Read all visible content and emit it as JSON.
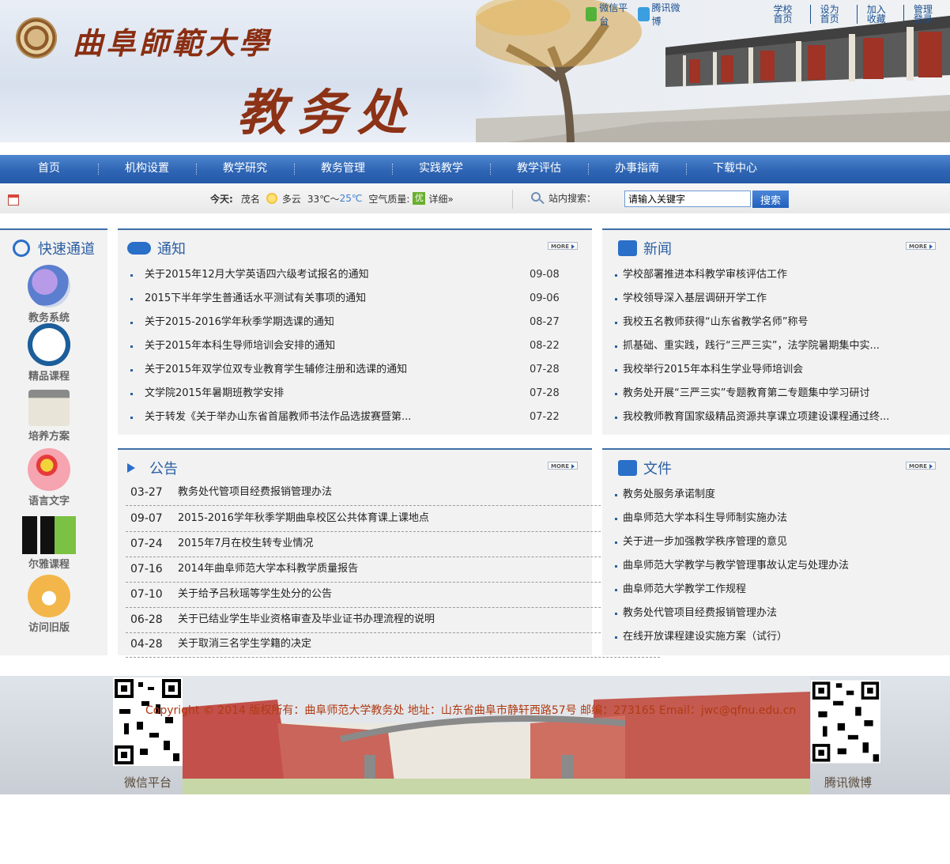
{
  "header": {
    "university_name": "曲阜師範大學",
    "office_name": "教务处",
    "social": [
      {
        "icon": "wechat-icon",
        "label": "微信平台"
      },
      {
        "icon": "weibo-icon",
        "label": "腾讯微博"
      }
    ],
    "top_links": [
      "学校首页",
      "设为首页",
      "加入收藏",
      "管理登录"
    ]
  },
  "nav": [
    "首页",
    "机构设置",
    "教学研究",
    "教务管理",
    "实践教学",
    "教学评估",
    "办事指南",
    "下载中心"
  ],
  "weather": {
    "today_label": "今天:",
    "location": "茂名",
    "condition": "多云",
    "temp_high": "33℃～",
    "temp_low": "25℃",
    "air_label": "空气质量:",
    "air_value": "优",
    "detail": "详细»"
  },
  "search": {
    "label": "站内搜索：",
    "value": "请输入关键字",
    "button": "搜索"
  },
  "quick_links": {
    "title": "快速通道",
    "items": [
      {
        "label": "教务系统",
        "icon": "academic-system-icon"
      },
      {
        "label": "精品课程",
        "icon": "quality-course-icon"
      },
      {
        "label": "培养方案",
        "icon": "news-paper-icon"
      },
      {
        "label": "语言文字",
        "icon": "language-icon"
      },
      {
        "label": "尔雅课程",
        "icon": "erya-logo"
      },
      {
        "label": "访问旧版",
        "icon": "old-version-icon"
      }
    ]
  },
  "notice": {
    "title": "通知",
    "more": "MORE",
    "items": [
      {
        "title": "关于2015年12月大学英语四六级考试报名的通知",
        "date": "09-08"
      },
      {
        "title": "2015下半年学生普通话水平测试有关事项的通知",
        "date": "09-06"
      },
      {
        "title": "关于2015-2016学年秋季学期选课的通知",
        "date": "08-27"
      },
      {
        "title": "关于2015年本科生导师培训会安排的通知",
        "date": "08-22"
      },
      {
        "title": "关于2015年双学位双专业教育学生辅修注册和选课的通知",
        "date": "07-28"
      },
      {
        "title": "文学院2015年暑期班教学安排",
        "date": "07-28"
      },
      {
        "title": "关于转发《关于举办山东省首届教师书法作品选拔赛暨第...",
        "date": "07-22"
      }
    ]
  },
  "news": {
    "title": "新闻",
    "more": "MORE",
    "items": [
      "学校部署推进本科教学审核评估工作",
      "学校领导深入基层调研开学工作",
      "我校五名教师获得“山东省教学名师”称号",
      "抓基础、重实践，践行“三严三实”，法学院暑期集中实...",
      "我校举行2015年本科生学业导师培训会",
      "教务处开展“三严三实”专题教育第二专题集中学习研讨",
      "我校教师教育国家级精品资源共享课立项建设课程通过终..."
    ]
  },
  "announce": {
    "title": "公告",
    "more": "MORE",
    "items": [
      {
        "date": "03-27",
        "title": "教务处代管项目经费报销管理办法"
      },
      {
        "date": "09-07",
        "title": "2015-2016学年秋季学期曲阜校区公共体育课上课地点"
      },
      {
        "date": "07-24",
        "title": "2015年7月在校生转专业情况"
      },
      {
        "date": "07-16",
        "title": "2014年曲阜师范大学本科教学质量报告"
      },
      {
        "date": "07-10",
        "title": "关于给予吕秋瑶等学生处分的公告"
      },
      {
        "date": "06-28",
        "title": "关于已结业学生毕业资格审查及毕业证书办理流程的说明"
      },
      {
        "date": "04-28",
        "title": "关于取消三名学生学籍的决定"
      }
    ]
  },
  "files": {
    "title": "文件",
    "more": "MORE",
    "items": [
      "教务处服务承诺制度",
      "曲阜师范大学本科生导师制实施办法",
      "关于进一步加强教学秩序管理的意见",
      "曲阜师范大学教学与教学管理事故认定与处理办法",
      "曲阜师范大学教学工作规程",
      "教务处代管项目经费报销管理办法",
      "在线开放课程建设实施方案（试行）"
    ]
  },
  "footer": {
    "copyright": "Copyright © 2014  版权所有：曲阜师范大学教务处    地址：山东省曲阜市静轩西路57号    邮编：273165    Email：jwc@qfnu.edu.cn",
    "qr_left_label": "微信平台",
    "qr_right_label": "腾讯微博"
  },
  "colors": {
    "nav_blue": "#2e65b4",
    "heading_blue": "#2a5fa3",
    "copyright_red": "#b03a12"
  }
}
